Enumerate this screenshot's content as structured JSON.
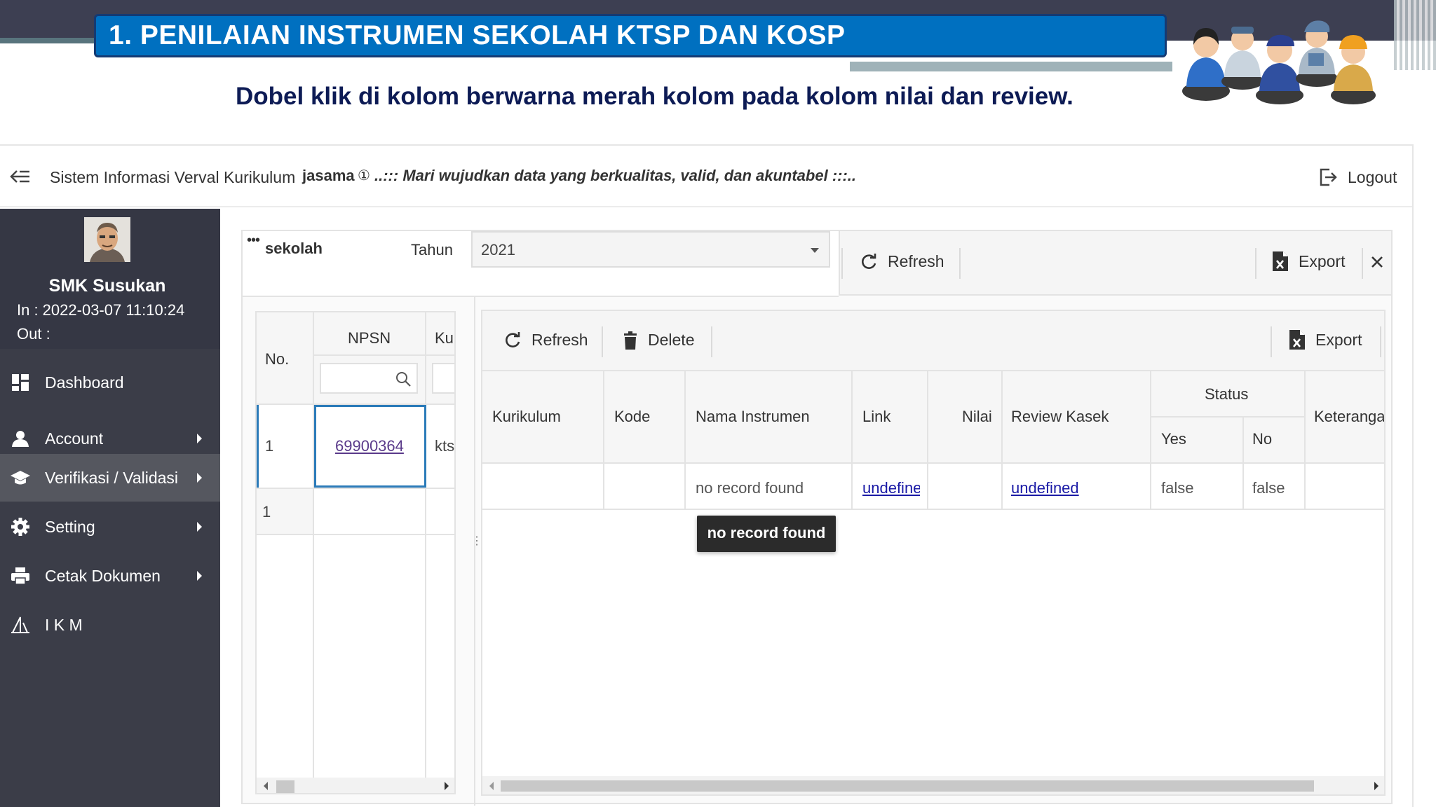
{
  "slide": {
    "title": "1. PENILAIAN INSTRUMEN SEKOLAH KTSP DAN KOSP",
    "subtitle": "Dobel klik di kolom berwarna merah kolom pada kolom nilai dan review."
  },
  "topbar": {
    "app_title": "Sistem Informasi Verval Kurikulum",
    "user": "jasama",
    "info_icon": "①",
    "marquee": "..::: Mari wujudkan data yang berkualitas, valid, dan akuntabel :::..",
    "logout_label": "Logout"
  },
  "sidebar": {
    "school": "SMK Susukan",
    "login_in": "In    : 2022-03-07 11:10:24",
    "login_out": "Out :",
    "items": [
      {
        "label": "Dashboard",
        "icon": "dashboard-icon",
        "submenu": false,
        "active": false
      },
      {
        "label": "Account",
        "icon": "user-icon",
        "submenu": true,
        "active": false
      },
      {
        "label": "Verifikasi / Validasi",
        "icon": "graduation-cap-icon",
        "submenu": true,
        "active": true
      },
      {
        "label": "Setting",
        "icon": "gear-icon",
        "submenu": true,
        "active": false
      },
      {
        "label": "Cetak Dokumen",
        "icon": "printer-icon",
        "submenu": true,
        "active": false
      },
      {
        "label": "I K M",
        "icon": "survey-icon",
        "submenu": false,
        "active": false
      }
    ]
  },
  "filter": {
    "dots": "•••",
    "sekolah_label": "sekolah",
    "tahun_label": "Tahun",
    "tahun_value": "2021"
  },
  "top_toolbar": {
    "refresh_label": "Refresh",
    "export_label": "Export"
  },
  "left_grid": {
    "headers": {
      "no": "No.",
      "npsn": "NPSN",
      "kurikulum": "Kur"
    },
    "rows": [
      {
        "no": "1",
        "npsn": "69900364",
        "kurikulum": "kts"
      }
    ],
    "footer_no": "1"
  },
  "right_grid": {
    "toolbar": {
      "refresh_label": "Refresh",
      "delete_label": "Delete",
      "export_label": "Export"
    },
    "headers": {
      "kurikulum": "Kurikulum",
      "kode": "Kode",
      "nama_instrumen": "Nama Instrumen",
      "link": "Link",
      "nilai": "Nilai",
      "review_kasek": "Review Kasek",
      "status": "Status",
      "yes": "Yes",
      "no": "No",
      "keterangan": "Keteranga"
    },
    "row": {
      "kurikulum": "",
      "kode": "",
      "nama_instrumen": "no record found",
      "link": "undefine",
      "nilai": "",
      "review_kasek": "undefined",
      "yes": "false",
      "no": "false",
      "keterangan": ""
    },
    "tooltip": "no record found"
  }
}
